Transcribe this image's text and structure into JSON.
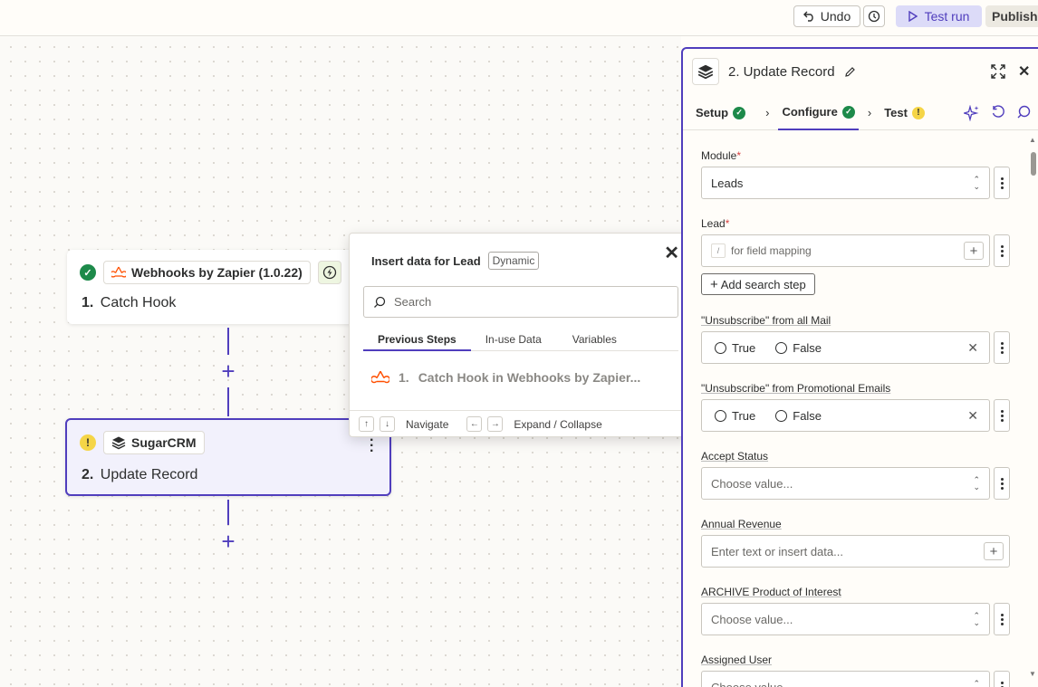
{
  "topbar": {
    "undo_label": "Undo",
    "test_run_label": "Test run",
    "publish_label": "Publish"
  },
  "canvas": {
    "step1": {
      "app_name": "Webhooks by Zapier (1.0.22)",
      "number": "1.",
      "title": "Catch Hook"
    },
    "step2": {
      "app_name": "SugarCRM",
      "number": "2.",
      "title": "Update Record"
    }
  },
  "popup": {
    "title": "Insert data for Lead",
    "badge": "Dynamic",
    "search_placeholder": "Search",
    "tabs": [
      "Previous Steps",
      "In-use Data",
      "Variables"
    ],
    "item_number": "1.",
    "item_label": "Catch Hook in Webhooks by Zapier...",
    "footer_navigate": "Navigate",
    "footer_expand": "Expand / Collapse"
  },
  "panel": {
    "title": "2. Update Record",
    "tabs": {
      "setup": "Setup",
      "configure": "Configure",
      "test": "Test"
    },
    "fields": {
      "module_label": "Module",
      "module_value": "Leads",
      "lead_label": "Lead",
      "lead_placeholder": "for field mapping",
      "lead_slash": "/",
      "add_search_step": "Add search step",
      "unsub_all_label": "\"Unsubscribe\" from all Mail",
      "unsub_promo_label": "\"Unsubscribe\" from Promotional Emails",
      "true_label": "True",
      "false_label": "False",
      "accept_status_label": "Accept Status",
      "choose_value": "Choose value...",
      "annual_revenue_label": "Annual Revenue",
      "annual_revenue_placeholder": "Enter text or insert data...",
      "archive_label": "ARCHIVE Product of Interest",
      "assigned_user_label": "Assigned User"
    }
  },
  "colors": {
    "accent": "#503ebd",
    "success": "#1d8a4a",
    "warning": "#f5d547",
    "webhook_orange": "#ff4f00"
  }
}
